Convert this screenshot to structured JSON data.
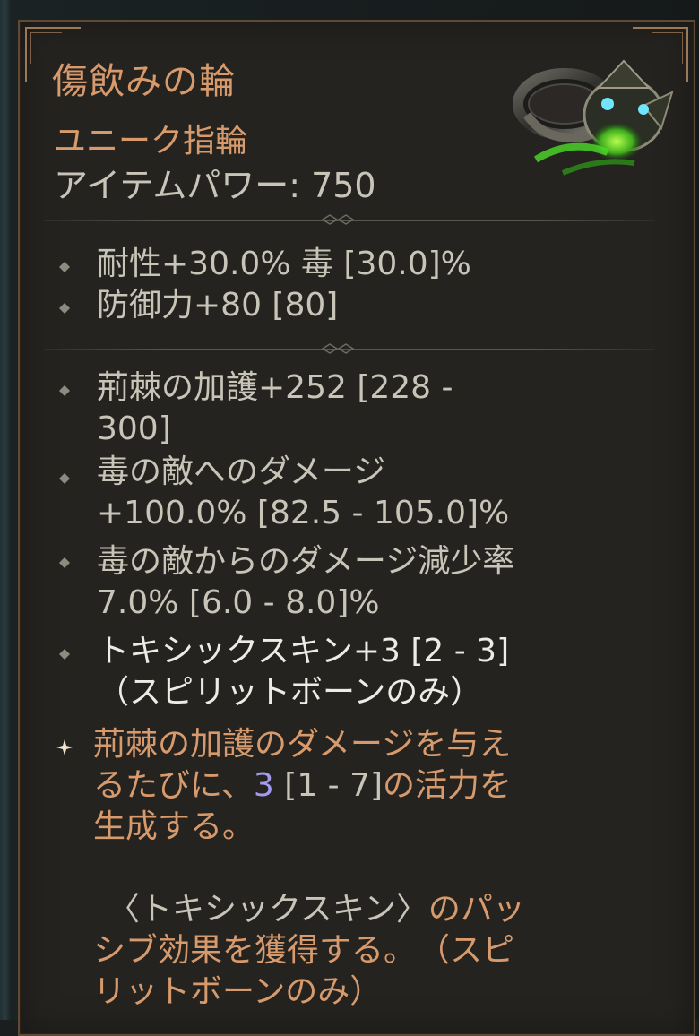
{
  "item": {
    "name": "傷飲みの輪",
    "rarity": "ユニーク指輪",
    "power": "アイテムパワー: 750"
  },
  "implicit_stats": [
    "耐性+30.0% 毒 [30.0]%",
    "防御力+80 [80]"
  ],
  "affix_stats": [
    {
      "line1": "荊棘の加護+252 [228 -",
      "line2": "300]"
    },
    {
      "line1": "毒の敵へのダメージ",
      "line2": "+100.0% [82.5 - 105.0]%"
    },
    {
      "line1": "毒の敵からのダメージ減少率",
      "line2": "7.0% [6.0 - 8.0]%"
    },
    {
      "line1": "トキシックスキン+3 [2 - 3]",
      "line2": "（スピリットボーンのみ）"
    }
  ],
  "unique_power": {
    "line1": "荊棘の加護のダメージを与え",
    "line2_a": "るたびに、",
    "value": "3",
    "range": " [1 - 7]",
    "line2_b": "の活力を",
    "line3": "生成する。",
    "passive_name": "〈トキシックスキン〉",
    "passive_a": "のパッ",
    "passive_line2": "シブ効果を獲得する。",
    "passive_note": "（スピ",
    "passive_line3": "リットボーンのみ）"
  },
  "colors": {
    "accent": "#d79a6c",
    "text": "#c8c4b8",
    "highlight": "#a29bf0",
    "background": "#252320"
  },
  "icons": {
    "item": "ring-icon",
    "bullet": "diamond-bullet-icon",
    "unique_bullet": "star-bullet-icon"
  }
}
